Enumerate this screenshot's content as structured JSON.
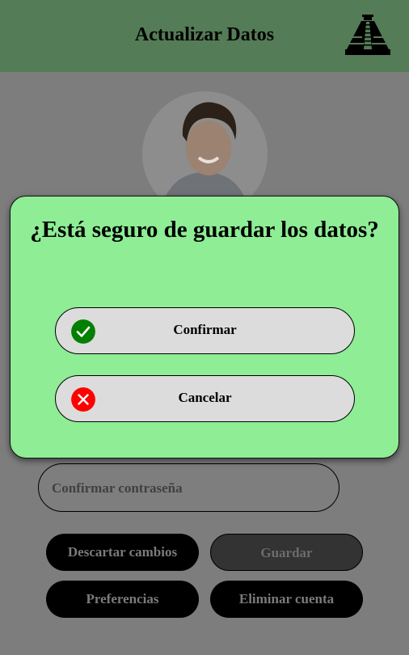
{
  "header": {
    "title": "Actualizar Datos",
    "logo_icon": "pyramid-icon"
  },
  "profile": {
    "avatar_icon": "user-photo"
  },
  "form": {
    "confirm_password_placeholder": "Confirmar contraseña"
  },
  "actions": {
    "discard_label": "Descartar cambios",
    "save_label": "Guardar",
    "preferences_label": "Preferencias",
    "delete_label": "Eliminar cuenta"
  },
  "dialog": {
    "title": "¿Está seguro de guardar los datos?",
    "confirm_label": "Confirmar",
    "cancel_label": "Cancelar",
    "confirm_icon": "check-circle-icon",
    "cancel_icon": "x-circle-icon"
  },
  "colors": {
    "header_bg": "#547c56",
    "dialog_bg": "#8eed95",
    "confirm_icon": "#038003",
    "cancel_icon": "#ff0000",
    "overlay": "#7d7d7d"
  }
}
